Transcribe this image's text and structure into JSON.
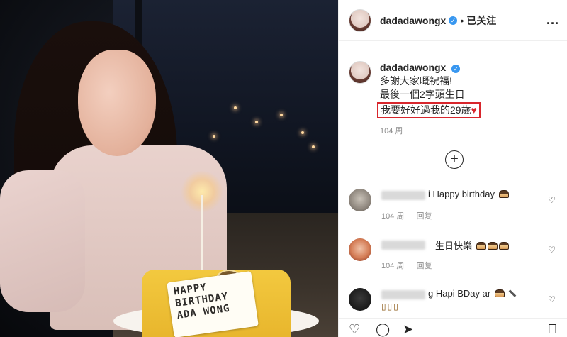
{
  "post": {
    "image_card": {
      "line1": "HAPPY",
      "line2": "BIRTHDAY",
      "line3": "ADA WONG"
    }
  },
  "header": {
    "username": "dadadawongx",
    "separator": "•",
    "follow_status": "已关注",
    "more": "..."
  },
  "caption": {
    "username": "dadadawongx",
    "lines": [
      "多謝大家嘅祝福!",
      "最後一個2字頭生日"
    ],
    "highlight_text": "我要好好過我的29歲",
    "highlight_heart": "♥",
    "time": "104 周"
  },
  "load_more": "+",
  "comments": [
    {
      "text": "i Happy birthday",
      "time": "104 周",
      "reply": "回复",
      "emoji": [
        "cake-emoji"
      ]
    },
    {
      "text": "生日快樂",
      "time": "104 周",
      "reply": "回复",
      "emoji": [
        "cake-emoji",
        "cake-emoji",
        "cake-emoji"
      ]
    },
    {
      "text": "g Hapi BDay ar",
      "time": "",
      "reply": "",
      "emoji": [
        "cake-emoji",
        "knife-emoji"
      ]
    }
  ],
  "icons": {
    "heart": "♡",
    "comment": "◯",
    "share": "➤",
    "save": "⎕"
  },
  "colors": {
    "accent_red": "#d8262c",
    "verified_blue": "#3897f0",
    "muted_text": "#8e8e8e"
  }
}
